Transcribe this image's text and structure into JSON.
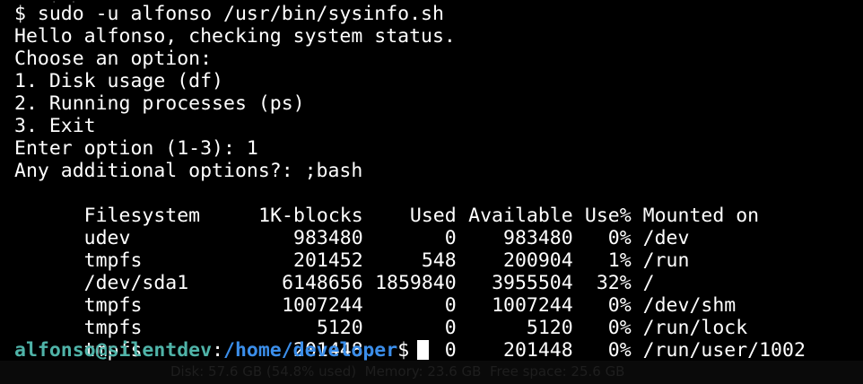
{
  "terminal": {
    "top_fragment": "· ·: ·:· · ·",
    "output_lines": [
      "$ sudo -u alfonso /usr/bin/sysinfo.sh",
      "Hello alfonso, checking system status.",
      "Choose an option:",
      "1. Disk usage (df)",
      "2. Running processes (ps)",
      "3. Exit",
      "Enter option (1-3): 1",
      "Any additional options?: ;bash"
    ],
    "df_table": {
      "headers": [
        "Filesystem",
        "1K-blocks",
        "Used",
        "Available",
        "Use%",
        "Mounted on"
      ],
      "rows": [
        [
          "udev",
          "983480",
          "0",
          "983480",
          "0%",
          "/dev"
        ],
        [
          "tmpfs",
          "201452",
          "548",
          "200904",
          "1%",
          "/run"
        ],
        [
          "/dev/sda1",
          "6148656",
          "1859840",
          "3955504",
          "32%",
          "/"
        ],
        [
          "tmpfs",
          "1007244",
          "0",
          "1007244",
          "0%",
          "/dev/shm"
        ],
        [
          "tmpfs",
          "5120",
          "0",
          "5120",
          "0%",
          "/run/lock"
        ],
        [
          "tmpfs",
          "201448",
          "0",
          "201448",
          "0%",
          "/run/user/1002"
        ]
      ]
    },
    "prompt": {
      "user_host": "alfonso@silentdev",
      "separator": ":",
      "path": "/home/developer",
      "symbol": "$"
    },
    "status_ghost_text": "Disk: 57.6 GB (54.8% used)  Memory: 23.6 GB  Free space: 25.6 GB"
  },
  "colors": {
    "background": "#000000",
    "foreground": "#ffffff",
    "prompt_user": "#4fb3a8",
    "prompt_path": "#3b8eea"
  }
}
